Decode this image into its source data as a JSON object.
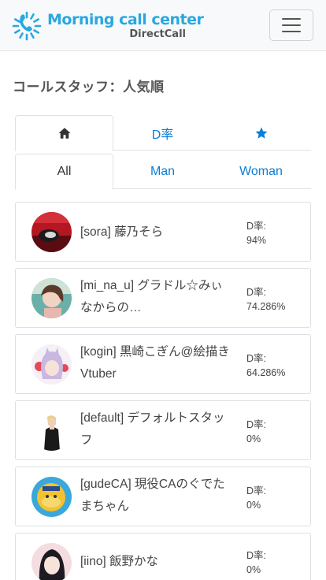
{
  "brand": {
    "title": "Morning call center",
    "subtitle": "DirectCall"
  },
  "page_title": "コールスタッフ：人気順",
  "sort_tabs": [
    {
      "icon": "home-icon",
      "label": ""
    },
    {
      "icon": "",
      "label": "D率"
    },
    {
      "icon": "star-icon",
      "label": ""
    }
  ],
  "gender_tabs": [
    {
      "label": "All"
    },
    {
      "label": "Man"
    },
    {
      "label": "Woman"
    }
  ],
  "rate_label": "D率:",
  "staff": [
    {
      "name": "[sora] 藤乃そら",
      "rate": "94%"
    },
    {
      "name": "[mi_na_u] グラドル☆みぃなからの…",
      "rate": "74.286%"
    },
    {
      "name": "[kogin] 黒崎こぎん@絵描きVtuber",
      "rate": "64.286%"
    },
    {
      "name": "[default] デフォルトスタッフ",
      "rate": "0%"
    },
    {
      "name": "[gudeCA] 現役CAのぐでたまちゃん",
      "rate": "0%"
    },
    {
      "name": "[iino] 飯野かな",
      "rate": "0%"
    }
  ],
  "colors": {
    "brand": "#29a8e0",
    "link": "#0a7fd6",
    "text": "#333333"
  }
}
